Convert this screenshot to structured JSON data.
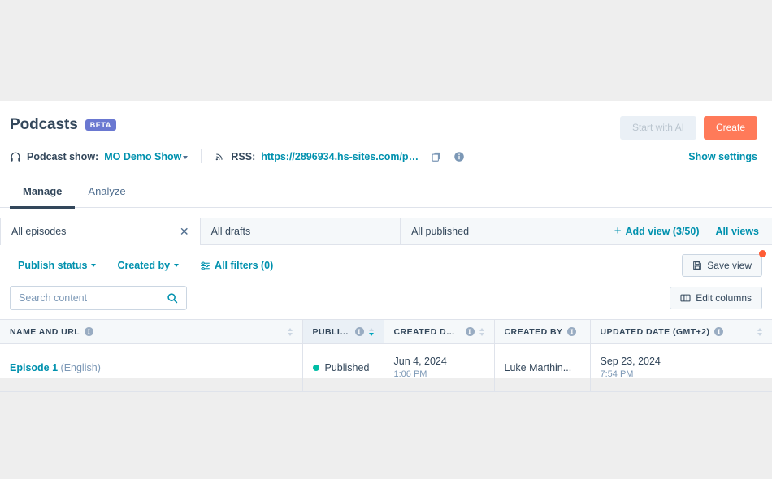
{
  "header": {
    "title": "Podcasts",
    "badge": "BETA",
    "start_with_ai_label": "Start with AI",
    "create_label": "Create"
  },
  "meta": {
    "headphones_icon": "headphones-icon",
    "show_label": "Podcast show:",
    "show_name": "MO Demo Show",
    "rss_icon": "rss-icon",
    "rss_label": "RSS:",
    "rss_url": "https://2896934.hs-sites.com/podcast...",
    "copy_icon": "copy-icon",
    "info_icon": "info-icon",
    "show_settings_label": "Show settings"
  },
  "nav_tabs": [
    {
      "label": "Manage",
      "active": true
    },
    {
      "label": "Analyze",
      "active": false
    }
  ],
  "view_tabs": [
    {
      "label": "All episodes",
      "active": true,
      "closable": true
    },
    {
      "label": "All drafts",
      "active": false,
      "closable": false
    },
    {
      "label": "All published",
      "active": false,
      "closable": false
    }
  ],
  "view_actions": {
    "add_view_label": "Add view (3/50)",
    "all_views_label": "All views"
  },
  "filters": {
    "publish_status_label": "Publish status",
    "created_by_label": "Created by",
    "all_filters_label": "All filters (0)",
    "save_view_label": "Save view",
    "has_unsaved_changes": true
  },
  "search": {
    "placeholder": "Search content",
    "value": "",
    "search_icon": "search-icon"
  },
  "toolbar": {
    "edit_columns_label": "Edit columns"
  },
  "table": {
    "columns": [
      {
        "label": "NAME AND URL",
        "has_info": true,
        "sortable": true,
        "sorted": false
      },
      {
        "label": "PUBLISH ST...",
        "has_info": true,
        "sortable": true,
        "sorted": true,
        "direction": "desc"
      },
      {
        "label": "CREATED DATE (...",
        "has_info": true,
        "sortable": true,
        "sorted": false
      },
      {
        "label": "CREATED BY",
        "has_info": true,
        "sortable": false,
        "sorted": false
      },
      {
        "label": "UPDATED DATE (GMT+2)",
        "has_info": true,
        "sortable": true,
        "sorted": false
      }
    ],
    "rows": [
      {
        "name": "Episode 1",
        "language": "(English)",
        "status": "Published",
        "status_color": "#00bda5",
        "created_date": "Jun 4, 2024",
        "created_time": "1:06 PM",
        "created_by": "Luke Marthin...",
        "updated_date": "Sep 23, 2024",
        "updated_time": "7:54 PM"
      }
    ]
  },
  "colors": {
    "accent_teal": "#0091ae",
    "primary_orange": "#ff7a59",
    "badge_indigo": "#6a78d1",
    "status_green": "#00bda5",
    "notification_orange": "#ff5c35"
  }
}
